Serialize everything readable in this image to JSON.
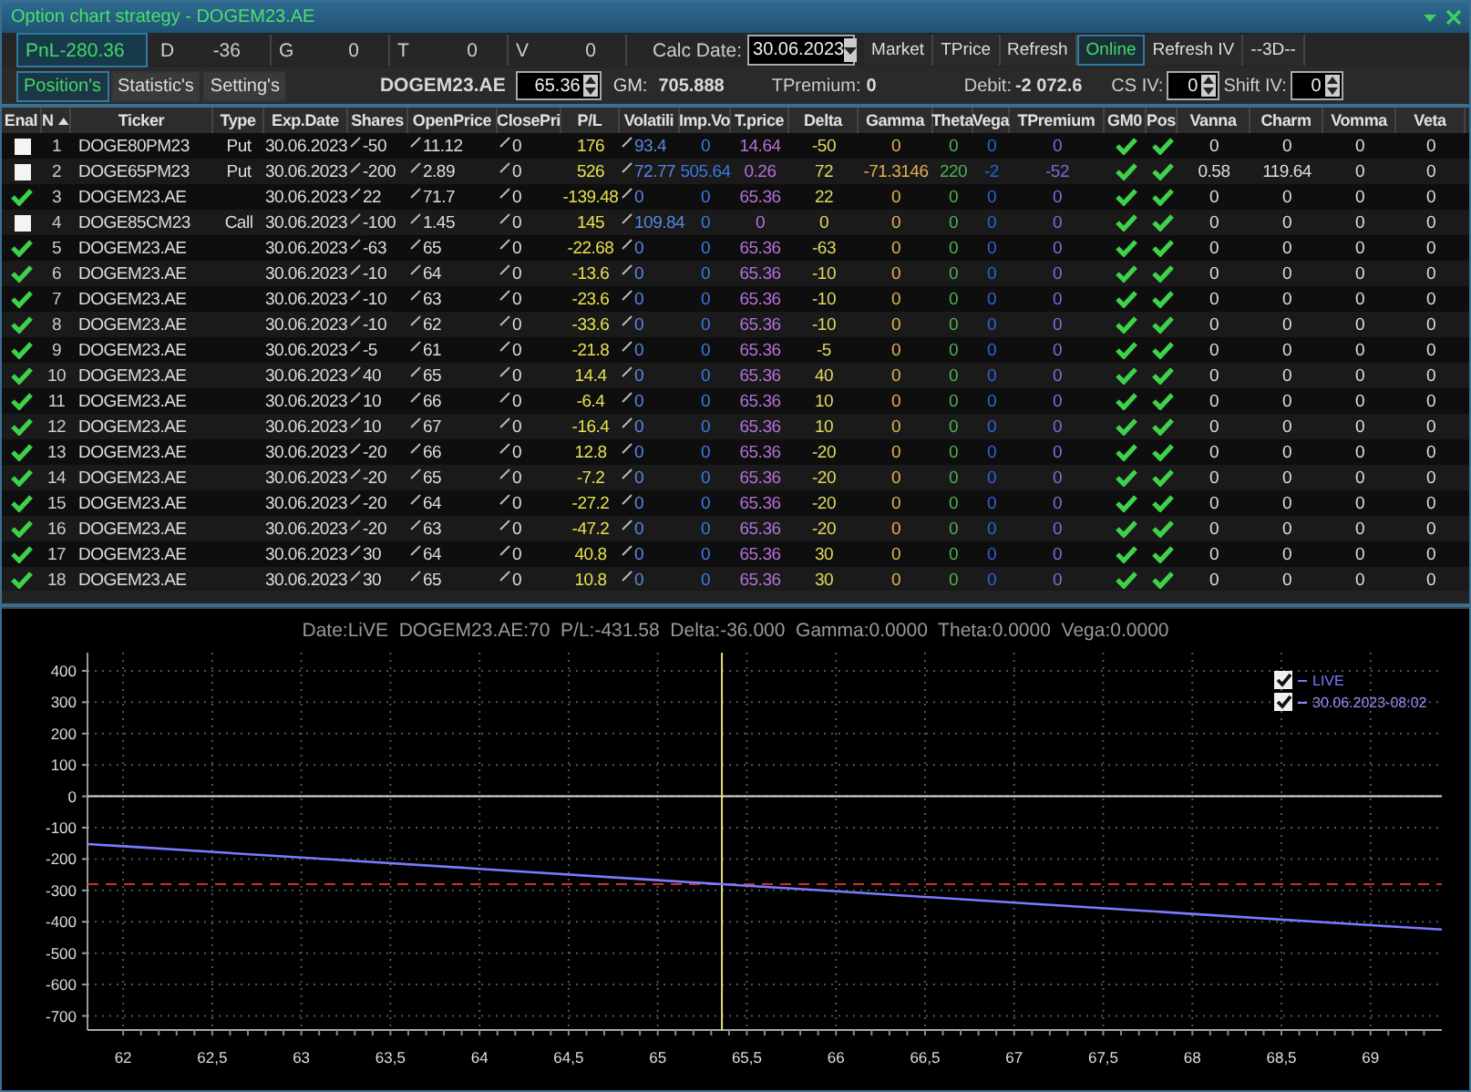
{
  "window": {
    "title": "Option chart strategy - DOGEM23.AE"
  },
  "stats": [
    {
      "label": "PnL",
      "value": "-280.36",
      "highlighted": true
    },
    {
      "label": "D",
      "value": "-36",
      "highlighted": false
    },
    {
      "label": "G",
      "value": "0",
      "highlighted": false
    },
    {
      "label": "T",
      "value": "0",
      "highlighted": false
    },
    {
      "label": "V",
      "value": "0",
      "highlighted": false
    }
  ],
  "calc_date": {
    "label": "Calc Date:",
    "value": "30.06.2023"
  },
  "buttons": [
    {
      "label": "Market",
      "selected": false
    },
    {
      "label": "TPrice",
      "selected": false
    },
    {
      "label": "Refresh",
      "selected": false
    },
    {
      "label": "Online",
      "selected": true
    },
    {
      "label": "Refresh IV",
      "selected": false
    },
    {
      "label": "--3D--",
      "selected": false
    }
  ],
  "tabs": [
    {
      "label": "Position's",
      "selected": true
    },
    {
      "label": "Statistic's",
      "selected": false
    },
    {
      "label": "Setting's",
      "selected": false
    }
  ],
  "ticker": "DOGEM23.AE",
  "price_field": {
    "value": "65.36"
  },
  "gm": {
    "label": "GM:",
    "value": "705.888"
  },
  "tpremium": {
    "label": "TPremium:",
    "value": "0"
  },
  "debit": {
    "label": "Debit:",
    "value": "-2 072.6"
  },
  "cs_iv": {
    "label": "CS IV:",
    "value": "0"
  },
  "shift_iv": {
    "label": "Shift IV:",
    "value": "0"
  },
  "table": {
    "columns": [
      {
        "label": "Enal"
      },
      {
        "label": "N"
      },
      {
        "label": "Ticker"
      },
      {
        "label": "Type"
      },
      {
        "label": "Exp.Date"
      },
      {
        "label": "Shares"
      },
      {
        "label": "OpenPrice"
      },
      {
        "label": "ClosePri"
      },
      {
        "label": "P/L"
      },
      {
        "label": "Volatili"
      },
      {
        "label": "Imp.Vo"
      },
      {
        "label": "T.price"
      },
      {
        "label": "Delta"
      },
      {
        "label": "Gamma"
      },
      {
        "label": "Theta"
      },
      {
        "label": "Vega"
      },
      {
        "label": "TPremium"
      },
      {
        "label": "GM0"
      },
      {
        "label": "Pos"
      },
      {
        "label": "Vanna"
      },
      {
        "label": "Charm"
      },
      {
        "label": "Vomma"
      },
      {
        "label": "Veta"
      }
    ],
    "rows": [
      {
        "enabled": false,
        "n": "1",
        "ticker": "DOGE80PM23",
        "type": "Put",
        "exp_date": "30.06.2023",
        "shares": "-50",
        "open_price": "11.12",
        "close_price": "0",
        "pl": "176",
        "volatility": "93.4",
        "imp_vol": "0",
        "t_price": "14.64",
        "delta": "-50",
        "gamma": "0",
        "theta": "0",
        "vega": "0",
        "t_premium": "0",
        "gm0": true,
        "pos": true,
        "vanna": "0",
        "charm": "0",
        "vomma": "0",
        "veta": "0"
      },
      {
        "enabled": false,
        "n": "2",
        "ticker": "DOGE65PM23",
        "type": "Put",
        "exp_date": "30.06.2023",
        "shares": "-200",
        "open_price": "2.89",
        "close_price": "0",
        "pl": "526",
        "volatility": "72.77",
        "imp_vol": "505.64",
        "t_price": "0.26",
        "delta": "72",
        "gamma": "-71.3146",
        "theta": "220",
        "vega": "-2",
        "t_premium": "-52",
        "gm0": true,
        "pos": true,
        "vanna": "0.58",
        "charm": "119.64",
        "vomma": "0",
        "veta": "0"
      },
      {
        "enabled": true,
        "n": "3",
        "ticker": "DOGEM23.AE",
        "exp_date": "30.06.2023",
        "shares": "22",
        "open_price": "71.7",
        "close_price": "0",
        "pl": "-139.48",
        "volatility": "0",
        "imp_vol": "0",
        "t_price": "65.36",
        "delta": "22",
        "gamma": "0",
        "theta": "0",
        "vega": "0",
        "t_premium": "0",
        "gm0": true,
        "pos": true,
        "vanna": "0",
        "charm": "0",
        "vomma": "0",
        "veta": "0"
      },
      {
        "enabled": false,
        "n": "4",
        "ticker": "DOGE85CM23",
        "type": "Call",
        "exp_date": "30.06.2023",
        "shares": "-100",
        "open_price": "1.45",
        "close_price": "0",
        "pl": "145",
        "volatility": "109.84",
        "imp_vol": "0",
        "t_price": "0",
        "delta": "0",
        "gamma": "0",
        "theta": "0",
        "vega": "0",
        "t_premium": "0",
        "gm0": true,
        "pos": true,
        "vanna": "0",
        "charm": "0",
        "vomma": "0",
        "veta": "0"
      },
      {
        "enabled": true,
        "n": "5",
        "ticker": "DOGEM23.AE",
        "exp_date": "30.06.2023",
        "shares": "-63",
        "open_price": "65",
        "close_price": "0",
        "pl": "-22.68",
        "volatility": "0",
        "imp_vol": "0",
        "t_price": "65.36",
        "delta": "-63",
        "gamma": "0",
        "theta": "0",
        "vega": "0",
        "t_premium": "0",
        "gm0": true,
        "pos": true,
        "vanna": "0",
        "charm": "0",
        "vomma": "0",
        "veta": "0"
      },
      {
        "enabled": true,
        "n": "6",
        "ticker": "DOGEM23.AE",
        "exp_date": "30.06.2023",
        "shares": "-10",
        "open_price": "64",
        "close_price": "0",
        "pl": "-13.6",
        "volatility": "0",
        "imp_vol": "0",
        "t_price": "65.36",
        "delta": "-10",
        "gamma": "0",
        "theta": "0",
        "vega": "0",
        "t_premium": "0",
        "gm0": true,
        "pos": true,
        "vanna": "0",
        "charm": "0",
        "vomma": "0",
        "veta": "0"
      },
      {
        "enabled": true,
        "n": "7",
        "ticker": "DOGEM23.AE",
        "exp_date": "30.06.2023",
        "shares": "-10",
        "open_price": "63",
        "close_price": "0",
        "pl": "-23.6",
        "volatility": "0",
        "imp_vol": "0",
        "t_price": "65.36",
        "delta": "-10",
        "gamma": "0",
        "theta": "0",
        "vega": "0",
        "t_premium": "0",
        "gm0": true,
        "pos": true,
        "vanna": "0",
        "charm": "0",
        "vomma": "0",
        "veta": "0"
      },
      {
        "enabled": true,
        "n": "8",
        "ticker": "DOGEM23.AE",
        "exp_date": "30.06.2023",
        "shares": "-10",
        "open_price": "62",
        "close_price": "0",
        "pl": "-33.6",
        "volatility": "0",
        "imp_vol": "0",
        "t_price": "65.36",
        "delta": "-10",
        "gamma": "0",
        "theta": "0",
        "vega": "0",
        "t_premium": "0",
        "gm0": true,
        "pos": true,
        "vanna": "0",
        "charm": "0",
        "vomma": "0",
        "veta": "0"
      },
      {
        "enabled": true,
        "n": "9",
        "ticker": "DOGEM23.AE",
        "exp_date": "30.06.2023",
        "shares": "-5",
        "open_price": "61",
        "close_price": "0",
        "pl": "-21.8",
        "volatility": "0",
        "imp_vol": "0",
        "t_price": "65.36",
        "delta": "-5",
        "gamma": "0",
        "theta": "0",
        "vega": "0",
        "t_premium": "0",
        "gm0": true,
        "pos": true,
        "vanna": "0",
        "charm": "0",
        "vomma": "0",
        "veta": "0"
      },
      {
        "enabled": true,
        "n": "10",
        "ticker": "DOGEM23.AE",
        "exp_date": "30.06.2023",
        "shares": "40",
        "open_price": "65",
        "close_price": "0",
        "pl": "14.4",
        "volatility": "0",
        "imp_vol": "0",
        "t_price": "65.36",
        "delta": "40",
        "gamma": "0",
        "theta": "0",
        "vega": "0",
        "t_premium": "0",
        "gm0": true,
        "pos": true,
        "vanna": "0",
        "charm": "0",
        "vomma": "0",
        "veta": "0"
      },
      {
        "enabled": true,
        "n": "11",
        "ticker": "DOGEM23.AE",
        "exp_date": "30.06.2023",
        "shares": "10",
        "open_price": "66",
        "close_price": "0",
        "pl": "-6.4",
        "volatility": "0",
        "imp_vol": "0",
        "t_price": "65.36",
        "delta": "10",
        "gamma": "0",
        "theta": "0",
        "vega": "0",
        "t_premium": "0",
        "gm0": true,
        "pos": true,
        "vanna": "0",
        "charm": "0",
        "vomma": "0",
        "veta": "0"
      },
      {
        "enabled": true,
        "n": "12",
        "ticker": "DOGEM23.AE",
        "exp_date": "30.06.2023",
        "shares": "10",
        "open_price": "67",
        "close_price": "0",
        "pl": "-16.4",
        "volatility": "0",
        "imp_vol": "0",
        "t_price": "65.36",
        "delta": "10",
        "gamma": "0",
        "theta": "0",
        "vega": "0",
        "t_premium": "0",
        "gm0": true,
        "pos": true,
        "vanna": "0",
        "charm": "0",
        "vomma": "0",
        "veta": "0"
      },
      {
        "enabled": true,
        "n": "13",
        "ticker": "DOGEM23.AE",
        "exp_date": "30.06.2023",
        "shares": "-20",
        "open_price": "66",
        "close_price": "0",
        "pl": "12.8",
        "volatility": "0",
        "imp_vol": "0",
        "t_price": "65.36",
        "delta": "-20",
        "gamma": "0",
        "theta": "0",
        "vega": "0",
        "t_premium": "0",
        "gm0": true,
        "pos": true,
        "vanna": "0",
        "charm": "0",
        "vomma": "0",
        "veta": "0"
      },
      {
        "enabled": true,
        "n": "14",
        "ticker": "DOGEM23.AE",
        "exp_date": "30.06.2023",
        "shares": "-20",
        "open_price": "65",
        "close_price": "0",
        "pl": "-7.2",
        "volatility": "0",
        "imp_vol": "0",
        "t_price": "65.36",
        "delta": "-20",
        "gamma": "0",
        "theta": "0",
        "vega": "0",
        "t_premium": "0",
        "gm0": true,
        "pos": true,
        "vanna": "0",
        "charm": "0",
        "vomma": "0",
        "veta": "0"
      },
      {
        "enabled": true,
        "n": "15",
        "ticker": "DOGEM23.AE",
        "exp_date": "30.06.2023",
        "shares": "-20",
        "open_price": "64",
        "close_price": "0",
        "pl": "-27.2",
        "volatility": "0",
        "imp_vol": "0",
        "t_price": "65.36",
        "delta": "-20",
        "gamma": "0",
        "theta": "0",
        "vega": "0",
        "t_premium": "0",
        "gm0": true,
        "pos": true,
        "vanna": "0",
        "charm": "0",
        "vomma": "0",
        "veta": "0"
      },
      {
        "enabled": true,
        "n": "16",
        "ticker": "DOGEM23.AE",
        "exp_date": "30.06.2023",
        "shares": "-20",
        "open_price": "63",
        "close_price": "0",
        "pl": "-47.2",
        "volatility": "0",
        "imp_vol": "0",
        "t_price": "65.36",
        "delta": "-20",
        "gamma": "0",
        "theta": "0",
        "vega": "0",
        "t_premium": "0",
        "gm0": true,
        "pos": true,
        "vanna": "0",
        "charm": "0",
        "vomma": "0",
        "veta": "0"
      },
      {
        "enabled": true,
        "n": "17",
        "ticker": "DOGEM23.AE",
        "exp_date": "30.06.2023",
        "shares": "30",
        "open_price": "64",
        "close_price": "0",
        "pl": "40.8",
        "volatility": "0",
        "imp_vol": "0",
        "t_price": "65.36",
        "delta": "30",
        "gamma": "0",
        "theta": "0",
        "vega": "0",
        "t_premium": "0",
        "gm0": true,
        "pos": true,
        "vanna": "0",
        "charm": "0",
        "vomma": "0",
        "veta": "0"
      },
      {
        "enabled": true,
        "n": "18",
        "ticker": "DOGEM23.AE",
        "exp_date": "30.06.2023",
        "shares": "30",
        "open_price": "65",
        "close_price": "0",
        "pl": "10.8",
        "volatility": "0",
        "imp_vol": "0",
        "t_price": "65.36",
        "delta": "30",
        "gamma": "0",
        "theta": "0",
        "vega": "0",
        "t_premium": "0",
        "gm0": true,
        "pos": true,
        "vanna": "0",
        "charm": "0",
        "vomma": "0",
        "veta": "0"
      }
    ]
  },
  "chart": {
    "title": "Date:LiVE  DOGEM23.AE:70  P/L:-431.58  Delta:-36.000  Gamma:0.0000  Theta:0.0000  Vega:0.0000",
    "legend": [
      {
        "checked": true
      },
      {
        "label": "30.06.2023-08:02",
        "checked": true,
        "color": "#9a8cff"
      }
    ],
    "chart_data": {
      "type": "line",
      "x": [
        61.8,
        62,
        63,
        64,
        65,
        65.36,
        66,
        67,
        68,
        69,
        69.4
      ],
      "series": [
        {
          "name": "LIVE",
          "color": "#7a7aff",
          "values": [
            -152,
            -159,
            -195,
            -231,
            -267,
            -280,
            -303,
            -339,
            -375,
            -411,
            -425
          ]
        }
      ],
      "xlim": [
        61.8,
        69.4
      ],
      "ylim": [
        -745,
        458
      ],
      "xticks": [
        62,
        {
          "value": 62.5,
          "label": "62,5"
        },
        63,
        {
          "value": 63.5,
          "label": "63,5"
        },
        64,
        {
          "value": 64.5,
          "label": "64,5"
        },
        65,
        {
          "value": 65.5,
          "label": "65,5"
        },
        66,
        {
          "value": 66.5,
          "label": "66,5"
        },
        67,
        {
          "value": 67.5,
          "label": "67,5"
        },
        68,
        {
          "value": 68.5,
          "label": "68,5"
        },
        69
      ],
      "yticks": [
        400,
        300,
        200,
        100,
        0,
        -100,
        -200,
        -300,
        -400,
        -500,
        -600,
        -700
      ],
      "grid": true,
      "ref_lines": [
        {
          "axis": "y",
          "value": -280.36,
          "color": "#d03030"
        },
        {
          "axis": "x",
          "value": 65.36,
          "color": "#e8e07a"
        }
      ]
    }
  }
}
